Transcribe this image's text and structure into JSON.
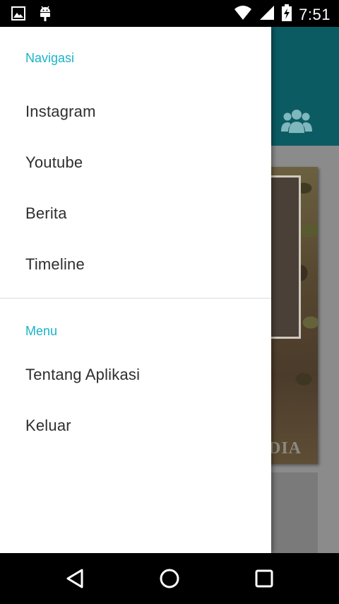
{
  "status_bar": {
    "time": "7:51",
    "left_icons": [
      "image-icon",
      "android-debug-icon"
    ],
    "right_icons": [
      "wifi-icon",
      "signal-icon",
      "battery-charging-icon"
    ]
  },
  "app_background": {
    "toolbar_color": "#0b5b63",
    "toolbar_icon": "group-icon",
    "card_watermark": "DIA"
  },
  "drawer": {
    "sections": [
      {
        "header": "Navigasi",
        "items": [
          "Instagram",
          "Youtube",
          "Berita",
          "Timeline"
        ]
      },
      {
        "header": "Menu",
        "items": [
          "Tentang Aplikasi",
          "Keluar"
        ]
      }
    ],
    "accent_color": "#1ab3c9"
  },
  "nav_bar": {
    "buttons": [
      "back-icon",
      "home-icon",
      "recents-icon"
    ]
  }
}
